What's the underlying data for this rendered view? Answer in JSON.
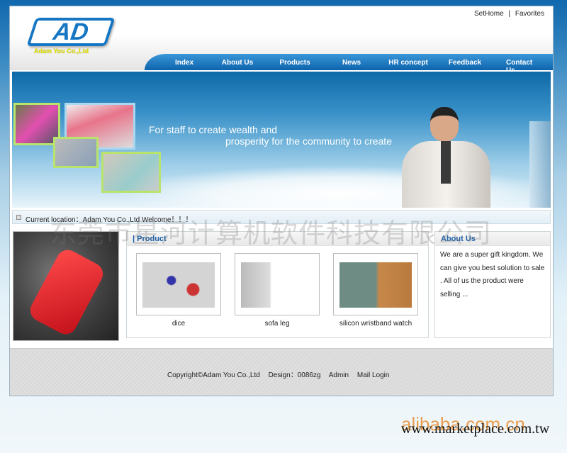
{
  "header": {
    "logo_text": "AD",
    "company_name": "Adam You Co.,Ltd",
    "top_links": [
      "SetHome",
      "Favorites"
    ],
    "separator": "|"
  },
  "nav": {
    "items": [
      "Index",
      "About Us",
      "Products",
      "News",
      "HR concept",
      "Feedback",
      "Contact Us"
    ]
  },
  "banner": {
    "slogan_line1": "For staff to create wealth and",
    "slogan_line2": "prosperity for the community to create"
  },
  "location": {
    "text": "Current location：Adam You Co.,Ltd Welcome！！！"
  },
  "product": {
    "title": "Product",
    "items": [
      {
        "label": "dice"
      },
      {
        "label": "sofa leg"
      },
      {
        "label": "silicon wristband watch"
      }
    ]
  },
  "about": {
    "title": "About Us",
    "text": "We are a super gift kingdom. We can give you best solution to sale . All of us the product were selling ..."
  },
  "footer": {
    "copyright": "Copyright©Adam You Co.,Ltd",
    "design": "Design：0086zg",
    "admin": "Admin",
    "mail_login": "Mail Login"
  },
  "watermarks": {
    "chinese": "东莞市星河计算机软件科技有限公司",
    "alibaba": "alibaba.com.cn",
    "marketplace": "www.marketplace.com.tw"
  },
  "colors": {
    "nav_blue": "#1577c4",
    "title_blue": "#1b5fa8",
    "photo_border": "#b9e46c"
  }
}
